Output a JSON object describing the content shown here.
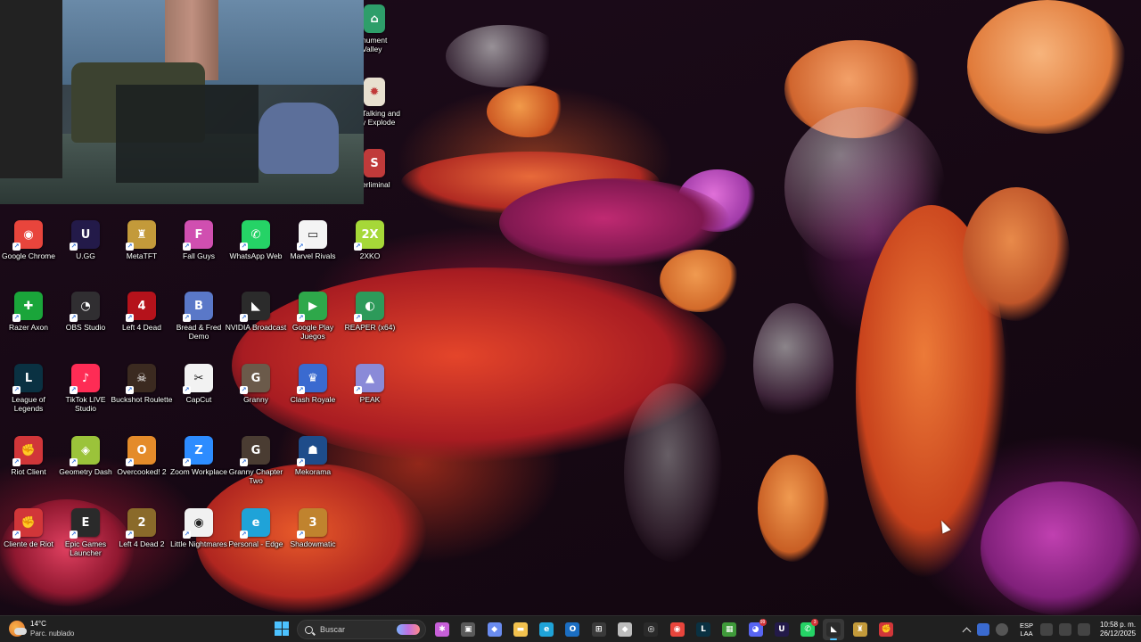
{
  "desktop": {
    "columns": [
      [
        {
          "label": "Google Chrome",
          "icon": "chrome-icon",
          "color": "#e8453c",
          "glyph": "◉"
        },
        {
          "label": "Razer Axon",
          "icon": "razer-axon-icon",
          "color": "#1aa53a",
          "glyph": "✚"
        },
        {
          "label": "League of Legends",
          "icon": "league-of-legends-icon",
          "color": "#0a3142",
          "glyph": "L"
        },
        {
          "label": "Riot Client",
          "icon": "riot-client-icon",
          "color": "#d13639",
          "glyph": "✊"
        },
        {
          "label": "Cliente de Riot",
          "icon": "riot-client-icon",
          "color": "#d13639",
          "glyph": "✊"
        }
      ],
      [
        {
          "label": "U.GG",
          "icon": "ugg-icon",
          "color": "#231a49",
          "glyph": "U"
        },
        {
          "label": "OBS Studio",
          "icon": "obs-icon",
          "color": "#302e31",
          "glyph": "◔"
        },
        {
          "label": "TikTok LIVE Studio",
          "icon": "tiktok-icon",
          "color": "#fe2c55",
          "glyph": "♪"
        },
        {
          "label": "Geometry Dash",
          "icon": "geometry-dash-icon",
          "color": "#9bc33a",
          "glyph": "◈"
        },
        {
          "label": "Epic Games Launcher",
          "icon": "epic-games-icon",
          "color": "#2a2a2a",
          "glyph": "E"
        }
      ],
      [
        {
          "label": "MetaTFT",
          "icon": "metatft-icon",
          "color": "#c39a3a",
          "glyph": "♜"
        },
        {
          "label": "Left 4 Dead",
          "icon": "left-4-dead-icon",
          "color": "#b5121b",
          "glyph": "4"
        },
        {
          "label": "Buckshot Roulette",
          "icon": "buckshot-roulette-icon",
          "color": "#3b2a20",
          "glyph": "☠"
        },
        {
          "label": "Overcooked! 2",
          "icon": "overcooked-icon",
          "color": "#e48b2a",
          "glyph": "O"
        },
        {
          "label": "Left 4 Dead 2",
          "icon": "left-4-dead-2-icon",
          "color": "#8a6a2a",
          "glyph": "2"
        }
      ],
      [
        {
          "label": "Fall Guys",
          "icon": "fall-guys-icon",
          "color": "#d04fb0",
          "glyph": "F"
        },
        {
          "label": "Bread & Fred Demo",
          "icon": "bread-fred-icon",
          "color": "#5a78c8",
          "glyph": "B"
        },
        {
          "label": "CapCut",
          "icon": "capcut-icon",
          "color": "#f2f2f2",
          "glyph": "✂"
        },
        {
          "label": "Zoom Workplace",
          "icon": "zoom-icon",
          "color": "#2d8cff",
          "glyph": "Z"
        },
        {
          "label": "Little Nightmares",
          "icon": "little-nightmares-icon",
          "color": "#f1f1f1",
          "glyph": "◉"
        }
      ],
      [
        {
          "label": "WhatsApp Web",
          "icon": "whatsapp-icon",
          "color": "#25d366",
          "glyph": "✆"
        },
        {
          "label": "NVIDIA Broadcast",
          "icon": "nvidia-icon",
          "color": "#2b2b2b",
          "glyph": "◣"
        },
        {
          "label": "Granny",
          "icon": "granny-icon",
          "color": "#6b5a4a",
          "glyph": "G"
        },
        {
          "label": "Granny Chapter Two",
          "icon": "granny-chapter-two-icon",
          "color": "#4a3c32",
          "glyph": "G"
        },
        {
          "label": "Personal - Edge",
          "icon": "edge-icon",
          "color": "#1fa3d8",
          "glyph": "e"
        }
      ],
      [
        {
          "label": "Marvel Rivals",
          "icon": "marvel-rivals-icon",
          "color": "#f4f4f4",
          "glyph": "▭"
        },
        {
          "label": "Google Play Juegos",
          "icon": "google-play-games-icon",
          "color": "#2ea84a",
          "glyph": "▶"
        },
        {
          "label": "Clash Royale",
          "icon": "clash-royale-icon",
          "color": "#3a6ad0",
          "glyph": "♛"
        },
        {
          "label": "Mekorama",
          "icon": "mekorama-icon",
          "color": "#1e4c8a",
          "glyph": "☗"
        },
        {
          "label": "Shadowmatic",
          "icon": "shadowmatic-icon",
          "color": "#c0832e",
          "glyph": "3"
        }
      ],
      [
        {
          "label": "2XKO",
          "icon": "2xko-icon",
          "color": "#a6d838",
          "glyph": "2X"
        },
        {
          "label": "REAPER (x64)",
          "icon": "reaper-icon",
          "color": "#2d9a5a",
          "glyph": "◐"
        },
        {
          "label": "PEAK",
          "icon": "peak-icon",
          "color": "#8a8ad8",
          "glyph": "▲"
        }
      ]
    ],
    "partial_icons": [
      {
        "label": "nument\nValley",
        "icon": "monument-valley-icon",
        "color": "#2e9e6a",
        "glyph": "⌂"
      },
      {
        "label": "Talking and\ny Explode",
        "icon": "keep-talking-icon",
        "color": "#e8e0d0",
        "glyph": "✹"
      },
      {
        "label": "erliminal",
        "icon": "superliminal-icon",
        "color": "#c03a3a",
        "glyph": "S"
      }
    ]
  },
  "taskbar": {
    "weather": {
      "temp": "14°C",
      "condition": "Parc. nublado"
    },
    "search_placeholder": "Buscar",
    "apps": [
      {
        "name": "widgets-icon",
        "color": "#c75fd8",
        "glyph": "✱",
        "active": false
      },
      {
        "name": "task-view-icon",
        "color": "#5a5a5a",
        "glyph": "▣",
        "active": false
      },
      {
        "name": "copilot-icon",
        "color": "#6a8cf0",
        "glyph": "◆",
        "active": false
      },
      {
        "name": "file-explorer-icon",
        "color": "#f2c14e",
        "glyph": "▬",
        "active": false
      },
      {
        "name": "edge-icon",
        "color": "#1fa3d8",
        "glyph": "e",
        "active": false
      },
      {
        "name": "outlook-icon",
        "color": "#1b6ec2",
        "glyph": "O",
        "active": false
      },
      {
        "name": "microsoft-store-icon",
        "color": "#3a3a3a",
        "glyph": "⊞",
        "active": false
      },
      {
        "name": "roblox-icon",
        "color": "#bdbdbd",
        "glyph": "◆",
        "active": false
      },
      {
        "name": "github-icon",
        "color": "#2a2a2a",
        "glyph": "◎",
        "active": false
      },
      {
        "name": "chrome-icon",
        "color": "#e8453c",
        "glyph": "◉",
        "active": false
      },
      {
        "name": "league-of-legends-icon",
        "color": "#0a3142",
        "glyph": "L",
        "active": false
      },
      {
        "name": "minecraft-icon",
        "color": "#3f9a3a",
        "glyph": "▦",
        "active": false
      },
      {
        "name": "discord-icon",
        "color": "#5865f2",
        "glyph": "◕",
        "active": false,
        "badge": "99"
      },
      {
        "name": "ugg-icon",
        "color": "#231a49",
        "glyph": "U",
        "active": false
      },
      {
        "name": "whatsapp-icon",
        "color": "#25d366",
        "glyph": "✆",
        "active": false,
        "badge": "3"
      },
      {
        "name": "nvidia-icon",
        "color": "#2b2b2b",
        "glyph": "◣",
        "active": true
      },
      {
        "name": "metatft-icon",
        "color": "#c39a3a",
        "glyph": "♜",
        "active": false
      },
      {
        "name": "riot-client-icon",
        "color": "#d13639",
        "glyph": "✊",
        "active": false
      }
    ],
    "tray": {
      "language": "ESP",
      "layout": "LAA",
      "time": "10:58 p. m.",
      "date": "26/12/2025"
    }
  }
}
